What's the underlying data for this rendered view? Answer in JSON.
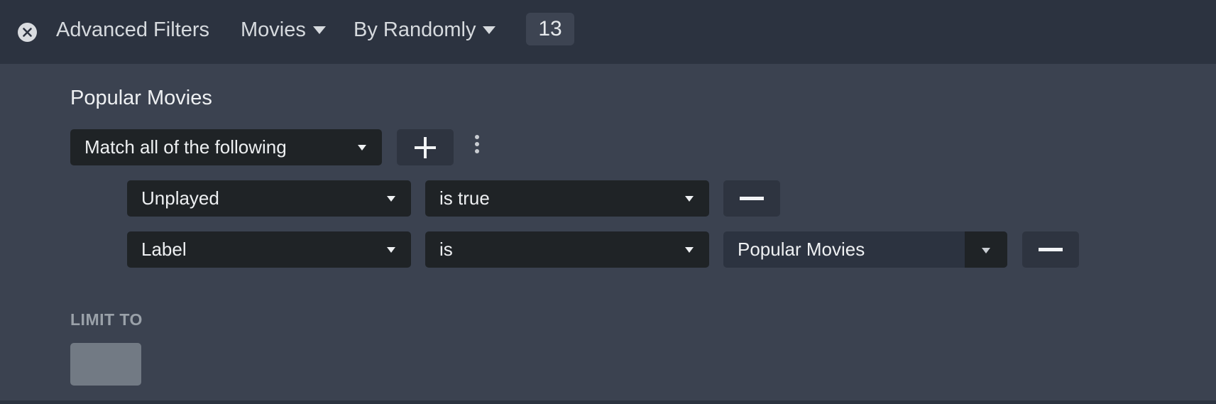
{
  "topbar": {
    "title": "Advanced Filters",
    "type_dropdown": "Movies",
    "sort_dropdown": "By Randomly",
    "count": "13"
  },
  "filter": {
    "name": "Popular Movies",
    "match_mode": "Match all of the following",
    "rules": [
      {
        "field": "Unplayed",
        "operator": "is true",
        "value": ""
      },
      {
        "field": "Label",
        "operator": "is",
        "value": "Popular Movies"
      }
    ]
  },
  "limit": {
    "label": "LIMIT TO"
  },
  "icons": {
    "close": "close-icon",
    "caret": "caret-down-icon",
    "add": "plus-icon",
    "more": "kebab-icon",
    "remove": "minus-icon"
  }
}
